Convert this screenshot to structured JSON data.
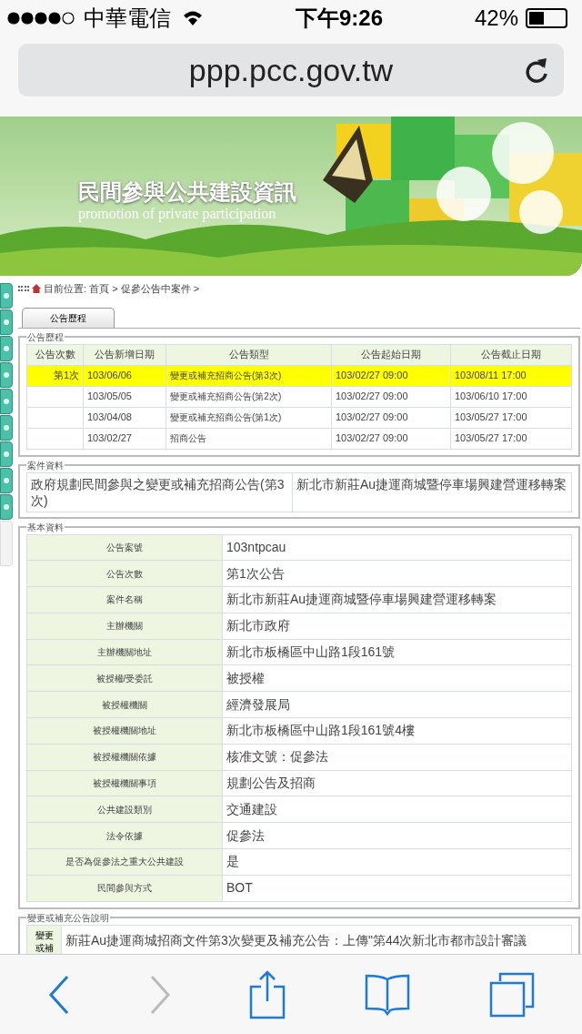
{
  "status_bar": {
    "carrier": "中華電信",
    "time": "下午9:26",
    "battery": "42%"
  },
  "address_bar": {
    "url": "ppp.pcc.gov.tw"
  },
  "banner": {
    "title": "民間參與公共建設資訊",
    "subtitle": "promotion of private participation"
  },
  "breadcrumb": "目前位置: 首頁 > 促參公告中案件 >",
  "tabs": [
    {
      "label": "公告歷程",
      "selected": true
    }
  ],
  "history": {
    "legend": "公告歷程",
    "columns": [
      "公告次數",
      "公告新增日期",
      "公告類型",
      "公告起始日期",
      "公告截止日期"
    ],
    "rows": [
      {
        "selected": true,
        "cells": [
          "第1次",
          "103/06/06",
          "變更或補充招商公告(第3次)",
          "103/02/27 09:00",
          "103/08/11 17:00"
        ]
      },
      {
        "selected": false,
        "cells": [
          "",
          "103/05/05",
          "變更或補充招商公告(第2次)",
          "103/02/27 09:00",
          "103/06/10 17:00"
        ]
      },
      {
        "selected": false,
        "cells": [
          "",
          "103/04/08",
          "變更或補充招商公告(第1次)",
          "103/02/27 09:00",
          "103/05/27 17:00"
        ]
      },
      {
        "selected": false,
        "cells": [
          "",
          "103/02/27",
          "招商公告",
          "103/02/27 09:00",
          "103/05/27 17:00"
        ]
      }
    ]
  },
  "case_info": {
    "legend": "案件資料",
    "cells": [
      "政府規劃民間參與之變更或補充招商公告(第3次)",
      "新北市新莊Au捷運商城暨停車場興建營運移轉案"
    ]
  },
  "basic_info": {
    "legend": "基本資料",
    "rows": [
      {
        "label": "公告案號",
        "value": "103ntpcau"
      },
      {
        "label": "公告次數",
        "value": "第1次公告"
      },
      {
        "label": "案件名稱",
        "value": "新北市新莊Au捷運商城暨停車場興建營運移轉案"
      },
      {
        "label": "主辦機關",
        "value": "新北市政府"
      },
      {
        "label": "主辦機關地址",
        "value": "新北市板橋區中山路1段161號"
      },
      {
        "label": "被授權/受委託",
        "value": "被授權"
      },
      {
        "label": "被授權機關",
        "value": "經濟發展局"
      },
      {
        "label": "被授權機關地址",
        "value": "新北市板橋區中山路1段161號4樓"
      },
      {
        "label": "被授權機關依據",
        "value": "核准文號：促參法"
      },
      {
        "label": "被授權機關事項",
        "value": "規劃公告及招商"
      },
      {
        "label": "公共建設類別",
        "value": "交通建設"
      },
      {
        "label": "法令依據",
        "value": "促參法"
      },
      {
        "label": "是否為促參法之重大公共建設",
        "value": "是"
      },
      {
        "label": "民間參與方式",
        "value": "BOT"
      }
    ]
  },
  "notice": {
    "legend": "變更或補充公告說明",
    "label": "變更或補",
    "text": "新莊Au捷運商城招商文件第3次變更及補充公告：上傳\"第44次新北市都市設計審議"
  },
  "toolbar": {
    "back_disabled": false,
    "forward_disabled": true
  }
}
